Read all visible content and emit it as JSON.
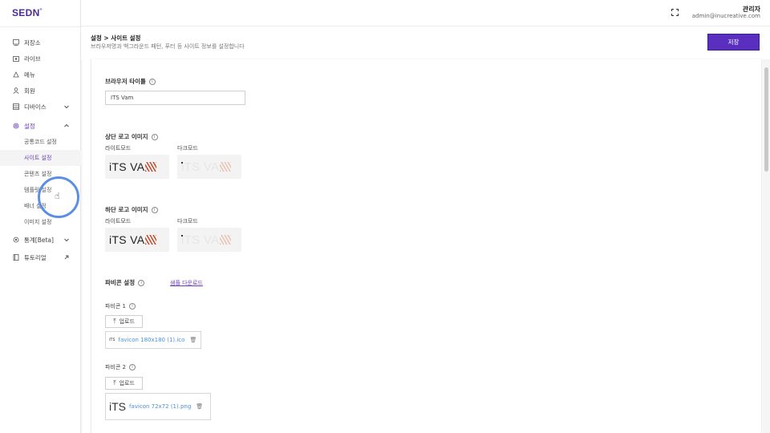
{
  "brand": {
    "logo": "SEDN"
  },
  "sidebar": {
    "items": [
      {
        "label": "저장소",
        "icon": "storage-icon"
      },
      {
        "label": "라이브",
        "icon": "live-icon"
      },
      {
        "label": "메뉴",
        "icon": "menu-icon"
      },
      {
        "label": "회원",
        "icon": "user-icon"
      },
      {
        "label": "디바이스",
        "icon": "device-icon"
      },
      {
        "label": "설정",
        "icon": "settings-icon"
      },
      {
        "label": "통계[Beta]",
        "icon": "stats-icon"
      },
      {
        "label": "튜토리얼",
        "icon": "tutorial-icon"
      }
    ],
    "settings_sub": [
      "공통코드 설정",
      "사이트 설정",
      "콘텐츠 설정",
      "템플릿 설정",
      "배너 설정",
      "이미지 설정"
    ],
    "active_sub": "사이트 설정"
  },
  "topbar": {
    "user_name": "관리자",
    "user_email": "admin@inucreative.com"
  },
  "header": {
    "breadcrumb": "설정 > 사이트 설정",
    "description": "브라우저명과 백그라운드 패턴, 푸터 등 사이트 정보를 설정합니다",
    "save_label": "저장"
  },
  "form": {
    "browser_title_label": "브라우저 타이틀",
    "browser_title_value": "ITS Vam",
    "top_logo_label": "상단 로고 이미지",
    "bottom_logo_label": "하단 로고 이미지",
    "light_mode": "라이트모드",
    "dark_mode": "다크모드",
    "logo_text": "iTS VA",
    "favicon_label": "파비콘 설정",
    "sample_download": "샘플 다운로드",
    "favicon1_label": "파비콘 1",
    "favicon2_label": "파비콘 2",
    "upload_label": "업로드",
    "favicon1_thumb": "iTS",
    "favicon1_file": "favicon 180x180 (1).ico",
    "favicon2_thumb": "iTS",
    "favicon2_file": "favicon 72x72 (1).png",
    "info_glyph": "i"
  },
  "colors": {
    "accent": "#5a2fbf",
    "brand": "#4a2a9b",
    "link": "#4a90d9",
    "cursor_ring": "#5b8ee6"
  }
}
